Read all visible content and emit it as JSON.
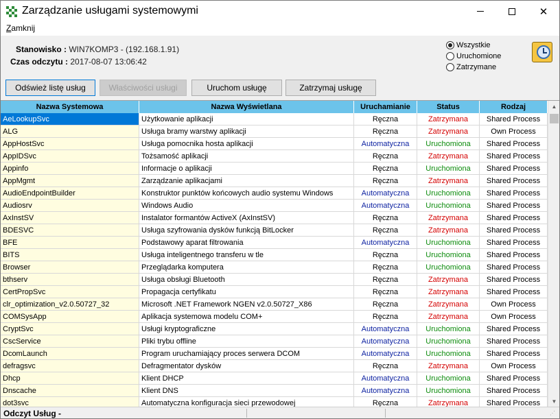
{
  "window": {
    "title": "Zarządzanie usługami systemowymi",
    "min_glyph": "—",
    "close_glyph": "✕"
  },
  "menu": {
    "items": [
      {
        "label": "Zamknij"
      }
    ]
  },
  "info": {
    "station_label": "Stanowisko :",
    "station_value": "WIN7KOMP3 - (192.168.1.91)",
    "read_time_label": "Czas odczytu :",
    "read_time_value": "2017-08-07 13:06:42"
  },
  "filters": {
    "selected": "Wszystkie",
    "options": [
      "Wszystkie",
      "Uruchomione",
      "Zatrzymane"
    ]
  },
  "toolbar": {
    "refresh_label": "Odśwież listę usług",
    "properties_label": "Właściwości usługi",
    "start_label": "Uruchom usługę",
    "stop_label": "Zatrzymaj usługę"
  },
  "table": {
    "columns": [
      "Nazwa Systemowa",
      "Nazwa Wyświetlana",
      "Uruchamianie",
      "Status",
      "Rodzaj"
    ],
    "rows": [
      [
        "AeLookupSvc",
        "Użytkowanie aplikacji",
        "Ręczna",
        "Zatrzymana",
        "Shared Process"
      ],
      [
        "ALG",
        "Usługa bramy warstwy aplikacji",
        "Ręczna",
        "Zatrzymana",
        "Own Process"
      ],
      [
        "AppHostSvc",
        "Usługa pomocnika hosta aplikacji",
        "Automatyczna",
        "Uruchomiona",
        "Shared Process"
      ],
      [
        "AppIDSvc",
        "Tożsamość aplikacji",
        "Ręczna",
        "Zatrzymana",
        "Shared Process"
      ],
      [
        "Appinfo",
        "Informacje o aplikacji",
        "Ręczna",
        "Uruchomiona",
        "Shared Process"
      ],
      [
        "AppMgmt",
        "Zarządzanie aplikacjami",
        "Ręczna",
        "Zatrzymana",
        "Shared Process"
      ],
      [
        "AudioEndpointBuilder",
        "Konstruktor punktów końcowych audio systemu Windows",
        "Automatyczna",
        "Uruchomiona",
        "Shared Process"
      ],
      [
        "Audiosrv",
        "Windows Audio",
        "Automatyczna",
        "Uruchomiona",
        "Shared Process"
      ],
      [
        "AxInstSV",
        "Instalator formantów ActiveX (AxInstSV)",
        "Ręczna",
        "Zatrzymana",
        "Shared Process"
      ],
      [
        "BDESVC",
        "Usługa szyfrowania dysków funkcją BitLocker",
        "Ręczna",
        "Zatrzymana",
        "Shared Process"
      ],
      [
        "BFE",
        "Podstawowy aparat filtrowania",
        "Automatyczna",
        "Uruchomiona",
        "Shared Process"
      ],
      [
        "BITS",
        "Usługa inteligentnego transferu w tle",
        "Ręczna",
        "Uruchomiona",
        "Shared Process"
      ],
      [
        "Browser",
        "Przeglądarka komputera",
        "Ręczna",
        "Uruchomiona",
        "Shared Process"
      ],
      [
        "bthserv",
        "Usługa obsługi Bluetooth",
        "Ręczna",
        "Zatrzymana",
        "Shared Process"
      ],
      [
        "CertPropSvc",
        "Propagacja certyfikatu",
        "Ręczna",
        "Zatrzymana",
        "Shared Process"
      ],
      [
        "clr_optimization_v2.0.50727_32",
        "Microsoft .NET Framework NGEN v2.0.50727_X86",
        "Ręczna",
        "Zatrzymana",
        "Own Process"
      ],
      [
        "COMSysApp",
        "Aplikacja systemowa modelu COM+",
        "Ręczna",
        "Zatrzymana",
        "Own Process"
      ],
      [
        "CryptSvc",
        "Usługi kryptograficzne",
        "Automatyczna",
        "Uruchomiona",
        "Shared Process"
      ],
      [
        "CscService",
        "Pliki trybu offline",
        "Automatyczna",
        "Uruchomiona",
        "Shared Process"
      ],
      [
        "DcomLaunch",
        "Program uruchamiający proces serwera DCOM",
        "Automatyczna",
        "Uruchomiona",
        "Shared Process"
      ],
      [
        "defragsvc",
        "Defragmentator dysków",
        "Ręczna",
        "Zatrzymana",
        "Own Process"
      ],
      [
        "Dhcp",
        "Klient DHCP",
        "Automatyczna",
        "Uruchomiona",
        "Shared Process"
      ],
      [
        "Dnscache",
        "Klient DNS",
        "Automatyczna",
        "Uruchomiona",
        "Shared Process"
      ],
      [
        "dot3svc",
        "Automatyczna konfiguracja sieci przewodowej",
        "Ręczna",
        "Zatrzymana",
        "Shared Process"
      ]
    ]
  },
  "status": {
    "text": "Odczyt Usług -"
  },
  "scroll": {
    "up_glyph": "▲",
    "down_glyph": "▼"
  },
  "colors": {
    "header_bg": "#6cc3ea",
    "name_col_bg": "#fffde0",
    "selected_bg": "#0078d7",
    "auto_text": "#0a1fa0",
    "running_text": "#0a8a0a",
    "stopped_text": "#d40000"
  },
  "icons": {
    "app": "green-checker-icon",
    "clock": "clock-icon"
  }
}
